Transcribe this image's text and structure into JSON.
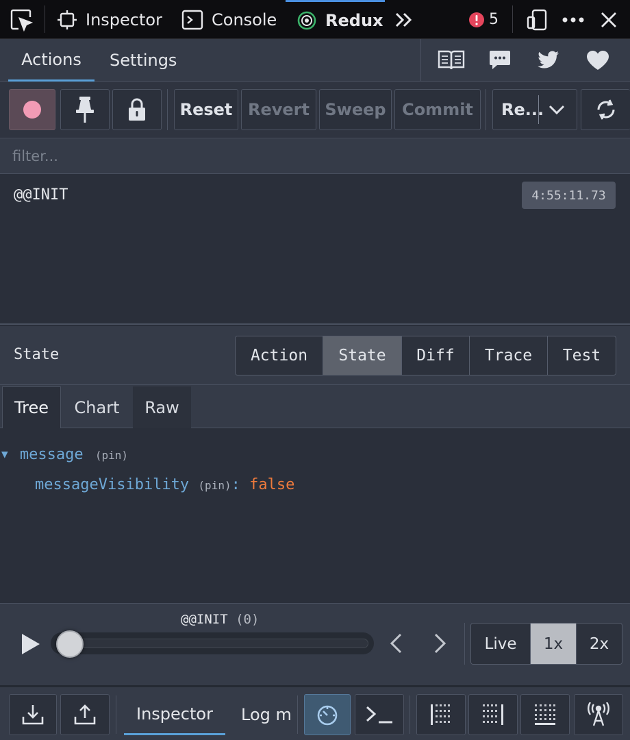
{
  "devtools": {
    "pick_icon": "cursor-pick-icon",
    "tabs": [
      {
        "label": "Inspector",
        "icon": "inspector-icon"
      },
      {
        "label": "Console",
        "icon": "console-icon"
      },
      {
        "label": "Redux",
        "icon": "redux-icon"
      }
    ],
    "overflow_icon": "chevron-double-right-icon",
    "error_count": "5",
    "colors": {
      "active_tab_indicator": "#4a90e2",
      "error": "#e5455c"
    }
  },
  "header": {
    "tabs": [
      {
        "label": "Actions",
        "active": true
      },
      {
        "label": "Settings",
        "active": false
      }
    ],
    "icons": [
      "book-icon",
      "chat-icon",
      "twitter-icon",
      "heart-icon"
    ]
  },
  "toolbar": {
    "reset_label": "Reset",
    "revert_label": "Revert",
    "sweep_label": "Sweep",
    "commit_label": "Commit",
    "instance_label": "Re...",
    "record_color": "#f29bb5"
  },
  "filter": {
    "placeholder": "filter..."
  },
  "actions": [
    {
      "type": "@@INIT",
      "time": "4:55:11.73"
    }
  ],
  "state_panel": {
    "title": "State",
    "tabs": [
      {
        "label": "Action",
        "active": false
      },
      {
        "label": "State",
        "active": true
      },
      {
        "label": "Diff",
        "active": false
      },
      {
        "label": "Trace",
        "active": false
      },
      {
        "label": "Test",
        "active": false
      }
    ],
    "sub_tabs": [
      {
        "label": "Tree",
        "active": true
      },
      {
        "label": "Chart",
        "active": false
      },
      {
        "label": "Raw",
        "active": false
      }
    ],
    "tree": {
      "root_key": "message",
      "root_pin": "(pin)",
      "child_key": "messageVisibility",
      "child_pin": "(pin)",
      "child_sep": ":",
      "child_value": "false"
    }
  },
  "slider": {
    "label": "@@INIT",
    "index_label": "(0)",
    "speeds": [
      {
        "label": "Live",
        "active": false
      },
      {
        "label": "1x",
        "active": true
      },
      {
        "label": "2x",
        "active": false
      }
    ]
  },
  "bottom_bar": {
    "inspector_label": "Inspector",
    "log_label": "Log m"
  }
}
